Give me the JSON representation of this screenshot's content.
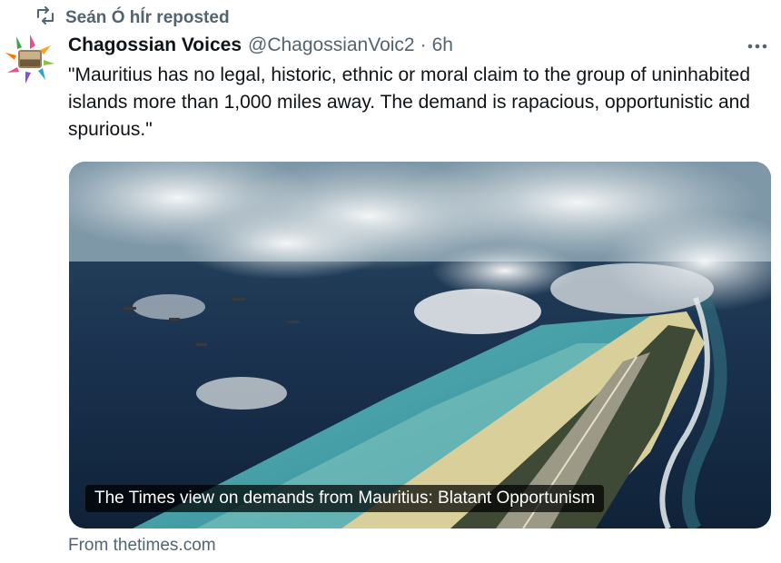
{
  "repost": {
    "label": "Seán Ó hÍr reposted",
    "icon": "repost-icon"
  },
  "author": {
    "display_name": "Chagossian Voices",
    "handle": "@ChagossianVoic2",
    "separator": "·",
    "time": "6h"
  },
  "more_icon": "more-horizontal-icon",
  "tweet": {
    "text": "\"Mauritius has no legal, historic, ethnic or moral claim to the group of uninhabited islands more than 1,000 miles away. The demand is rapacious, opportunistic and spurious.\""
  },
  "card": {
    "caption": "The Times view on demands from Mauritius: Blatant Opportunism",
    "source": "From thetimes.com"
  },
  "colors": {
    "text_primary": "#0f1419",
    "text_secondary": "#536471",
    "background": "#ffffff"
  }
}
